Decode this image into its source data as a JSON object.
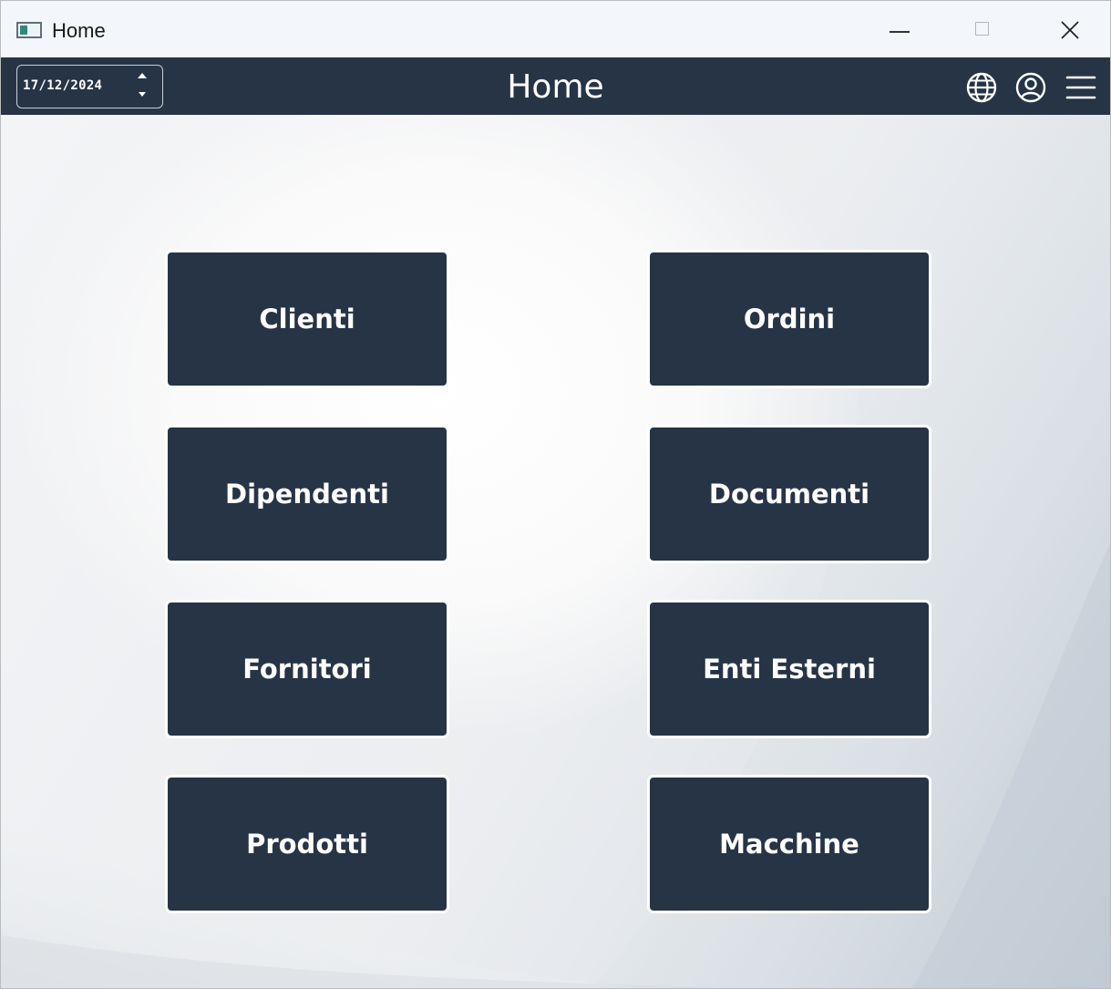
{
  "window": {
    "title": "Home"
  },
  "header": {
    "date_value": "17/12/2024",
    "title": "Home"
  },
  "icons": {
    "app": "app-window-icon",
    "minimize": "minimize-icon",
    "maximize": "maximize-icon",
    "close": "close-icon",
    "language": "globe-icon",
    "account": "user-circle-icon",
    "menu": "hamburger-menu-icon"
  },
  "tiles": [
    {
      "label": "Clienti"
    },
    {
      "label": "Ordini"
    },
    {
      "label": "Dipendenti"
    },
    {
      "label": "Documenti"
    },
    {
      "label": "Fornitori"
    },
    {
      "label": "Enti Esterni"
    },
    {
      "label": "Prodotti"
    },
    {
      "label": "Macchine"
    }
  ],
  "colors": {
    "primary": "#263446",
    "text_on_primary": "#ffffff",
    "titlebar": "#f3f6fb"
  }
}
